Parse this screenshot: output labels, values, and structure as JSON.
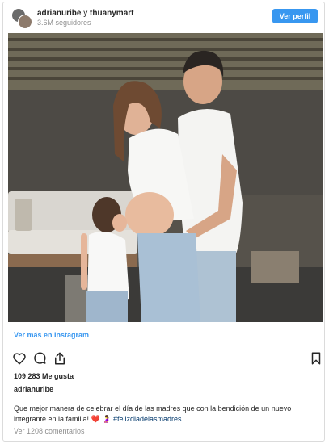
{
  "header": {
    "user1": "adrianuribe",
    "joiner": "y",
    "user2": "thuanymart",
    "followers": "3.6M seguidores",
    "profile_button": "Ver perfil"
  },
  "image": {
    "description": "photo"
  },
  "more_link": "Ver más en Instagram",
  "actions": {
    "like_icon": "heart-icon",
    "comment_icon": "comment-icon",
    "share_icon": "share-icon",
    "save_icon": "bookmark-icon"
  },
  "likes": "109 283 Me gusta",
  "owner": "adrianuribe",
  "caption": {
    "text": "Que mejor manera de celebrar el día de las madres que con la bendición de un nuevo integrante en la familia! ❤️ 🤰",
    "hashtag": "#felizdiadelasmadres"
  },
  "comments_link": "Ver 1208 comentarios",
  "colors": {
    "accent": "#3897f0",
    "text": "#262626",
    "muted": "#8e8e8e",
    "border": "#dbdbdb"
  }
}
